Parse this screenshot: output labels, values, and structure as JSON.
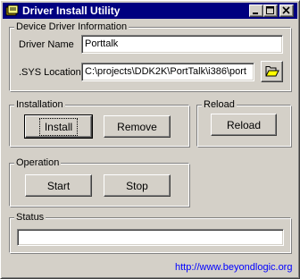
{
  "window": {
    "title": "Driver Install Utility"
  },
  "device_driver_info": {
    "legend": "Device Driver Information",
    "driver_name_label": "Driver Name",
    "driver_name_value": "Porttalk",
    "sys_location_label": ".SYS Location",
    "sys_location_value": "C:\\projects\\DDK2K\\PortTalk\\i386\\port",
    "browse_icon": "folder-open-icon"
  },
  "installation": {
    "legend": "Installation",
    "install_label": "Install",
    "remove_label": "Remove"
  },
  "reload": {
    "legend": "Reload",
    "reload_label": "Reload"
  },
  "operation": {
    "legend": "Operation",
    "start_label": "Start",
    "stop_label": "Stop"
  },
  "status": {
    "legend": "Status",
    "value": ""
  },
  "footer": {
    "link_text": "http://www.beyondlogic.org"
  },
  "colors": {
    "titlebar": "#000080",
    "face": "#d4d0c8",
    "link": "#0000ff"
  }
}
